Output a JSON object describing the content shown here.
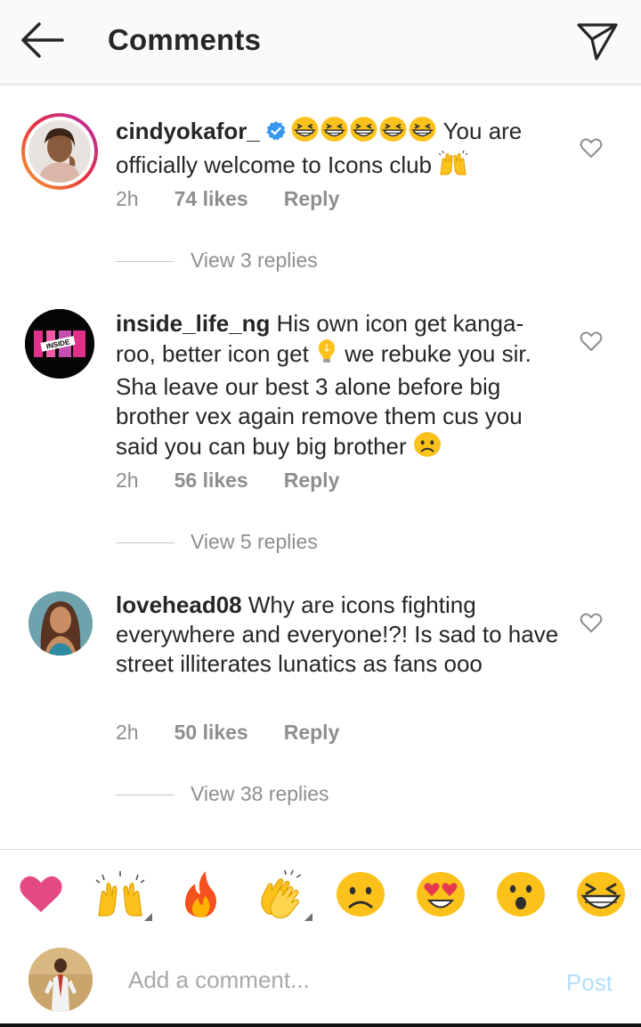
{
  "header": {
    "title": "Comments",
    "back_icon": "arrow-left-icon",
    "send_icon": "paper-plane-icon"
  },
  "comments": [
    {
      "username": "cindyokafor_",
      "verified": true,
      "pre_emojis": [
        "grinning-squint-face",
        "grinning-squint-face",
        "grinning-squint-face",
        "grinning-squint-face",
        "grinning-squint-face"
      ],
      "text": "You are officially welcome to Icons club",
      "post_emoji": "raising-hands",
      "time": "2h",
      "likes": "74 likes",
      "reply": "Reply",
      "view_replies": "View 3 replies"
    },
    {
      "username": "inside_life_ng",
      "text_part1": "His own icon get kanga-roo, better icon get",
      "mid_emoji": "light-bulb",
      "text_part2": "we rebuke you sir. Sha leave our best 3 alone before big brother vex again remove them cus you said you can buy big brother",
      "post_emoji": "sad-face",
      "time": "2h",
      "likes": "56 likes",
      "reply": "Reply",
      "view_replies": "View 5 replies"
    },
    {
      "username": "lovehead08",
      "text": "Why are icons fighting everywhere and everyone!?! Is sad to have street illiterates lunatics as fans ooo",
      "time": "2h",
      "likes": "50 likes",
      "reply": "Reply",
      "view_replies": "View 38 replies"
    }
  ],
  "emoji_bar": [
    "heart",
    "raising-hands",
    "fire",
    "clapping-hands",
    "sad-face",
    "heart-eyes",
    "surprised-face",
    "grinning-squint-face"
  ],
  "composer": {
    "placeholder": "Add a comment...",
    "post_label": "Post"
  },
  "colors": {
    "accent_blue": "#3897f0",
    "post_disabled": "#b2dffc",
    "muted_text": "#8e8e8e",
    "story_ring": [
      "#f8a732",
      "#e3333e",
      "#b72cb0"
    ]
  }
}
